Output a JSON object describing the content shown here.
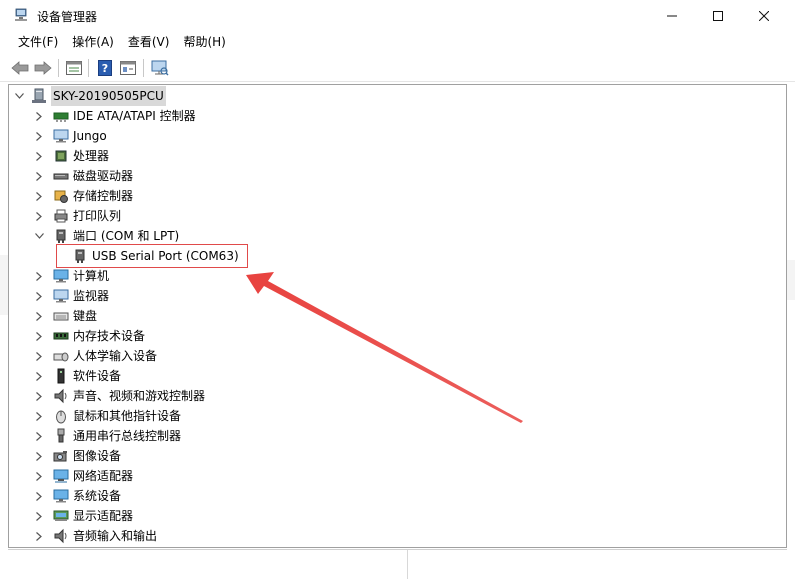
{
  "window": {
    "title": "设备管理器",
    "controls": {
      "minimize": "—",
      "maximize": "☐",
      "close": "✕"
    }
  },
  "menu": {
    "items": [
      {
        "label": "文件(F)"
      },
      {
        "label": "操作(A)"
      },
      {
        "label": "查看(V)"
      },
      {
        "label": "帮助(H)"
      }
    ]
  },
  "toolbar": {
    "buttons": [
      "back-icon",
      "forward-icon",
      "properties-icon",
      "help-icon",
      "update-driver-icon",
      "scan-hardware-icon"
    ]
  },
  "tree": {
    "root": {
      "label": "SKY-20190505PCU",
      "icon": "computer-icon",
      "expanded": true
    },
    "items": [
      {
        "label": "IDE ATA/ATAPI 控制器",
        "icon": "ide-controller-icon",
        "expanded": false
      },
      {
        "label": "Jungo",
        "icon": "monitor-icon",
        "expanded": false
      },
      {
        "label": "处理器",
        "icon": "processor-icon",
        "expanded": false
      },
      {
        "label": "磁盘驱动器",
        "icon": "disk-drive-icon",
        "expanded": false
      },
      {
        "label": "存储控制器",
        "icon": "storage-controller-icon",
        "expanded": false
      },
      {
        "label": "打印队列",
        "icon": "printer-icon",
        "expanded": false
      },
      {
        "label": "端口 (COM 和 LPT)",
        "icon": "port-icon",
        "expanded": true,
        "children": [
          {
            "label": "USB Serial Port (COM63)",
            "icon": "port-icon"
          }
        ]
      },
      {
        "label": "计算机",
        "icon": "computer-monitor-icon",
        "expanded": false
      },
      {
        "label": "监视器",
        "icon": "monitor-icon",
        "expanded": false
      },
      {
        "label": "键盘",
        "icon": "keyboard-icon",
        "expanded": false
      },
      {
        "label": "内存技术设备",
        "icon": "memory-icon",
        "expanded": false
      },
      {
        "label": "人体学输入设备",
        "icon": "hid-icon",
        "expanded": false
      },
      {
        "label": "软件设备",
        "icon": "software-device-icon",
        "expanded": false
      },
      {
        "label": "声音、视频和游戏控制器",
        "icon": "sound-icon",
        "expanded": false
      },
      {
        "label": "鼠标和其他指针设备",
        "icon": "mouse-icon",
        "expanded": false
      },
      {
        "label": "通用串行总线控制器",
        "icon": "usb-icon",
        "expanded": false
      },
      {
        "label": "图像设备",
        "icon": "camera-icon",
        "expanded": false
      },
      {
        "label": "网络适配器",
        "icon": "network-icon",
        "expanded": false
      },
      {
        "label": "系统设备",
        "icon": "system-device-icon",
        "expanded": false
      },
      {
        "label": "显示适配器",
        "icon": "display-adapter-icon",
        "expanded": false
      },
      {
        "label": "音频输入和输出",
        "icon": "audio-icon",
        "expanded": false
      }
    ]
  },
  "annotation": {
    "highlight_color": "#e04a4a",
    "arrow_color": "#e8423f"
  }
}
